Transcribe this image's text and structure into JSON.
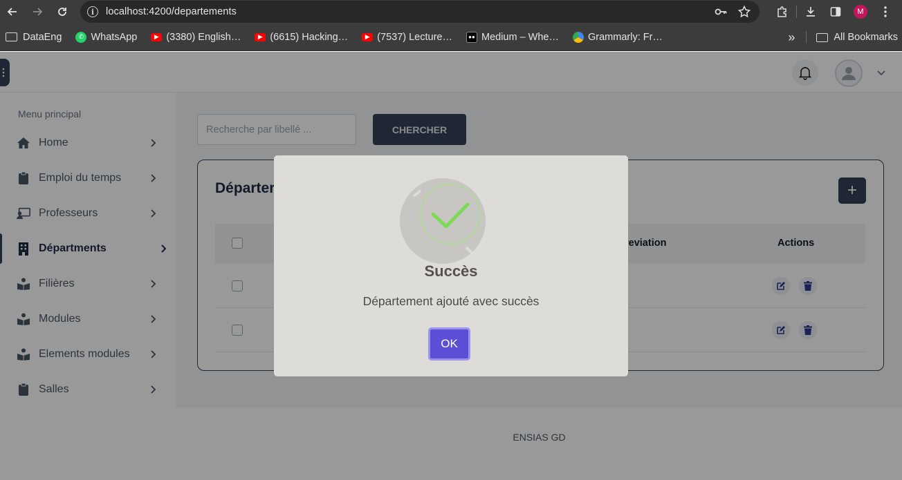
{
  "browser": {
    "url_host": "localhost",
    "url_path": ":4200/departements",
    "profile_initial": "M",
    "bookmarks": [
      {
        "label": "DataEng",
        "icon": "folder-icon"
      },
      {
        "label": "WhatsApp",
        "icon": "whatsapp-icon",
        "color": "#25d366"
      },
      {
        "label": "(3380) English…",
        "icon": "youtube-icon",
        "color": "#ff0000"
      },
      {
        "label": "(6615) Hacking…",
        "icon": "youtube-icon",
        "color": "#ff0000"
      },
      {
        "label": "(7537) Lecture…",
        "icon": "youtube-icon",
        "color": "#ff0000"
      },
      {
        "label": "Medium – Whe…",
        "icon": "medium-icon",
        "color": "#000000"
      },
      {
        "label": "Grammarly: Fr…",
        "icon": "chrome-webstore-icon"
      }
    ],
    "all_bookmarks_label": "All Bookmarks",
    "overflow_label": "»"
  },
  "app": {
    "sidebar": {
      "title": "Menu principal",
      "items": [
        {
          "label": "Home",
          "icon": "home-icon"
        },
        {
          "label": "Emploi du temps",
          "icon": "clipboard-icon"
        },
        {
          "label": "Professeurs",
          "icon": "teacher-icon"
        },
        {
          "label": "Départments",
          "icon": "building-icon",
          "active": true
        },
        {
          "label": "Filières",
          "icon": "books-icon"
        },
        {
          "label": "Modules",
          "icon": "books-icon"
        },
        {
          "label": "Elements modules",
          "icon": "books-icon"
        },
        {
          "label": "Salles",
          "icon": "clipboard-icon"
        }
      ]
    },
    "search": {
      "placeholder": "Recherche par libellé ...",
      "button_label": "CHERCHER"
    },
    "card": {
      "title": "Départer",
      "add_label": "+",
      "columns": [
        "reviation",
        "Actions"
      ],
      "row_count": 2
    },
    "footer": "ENSIAS GD",
    "colors": {
      "primary": "#334155",
      "ok_button": "#5b4fd6",
      "success": "#a5dc86"
    }
  },
  "modal": {
    "title": "Succès",
    "message": "Département ajouté avec succès",
    "ok_label": "OK"
  }
}
